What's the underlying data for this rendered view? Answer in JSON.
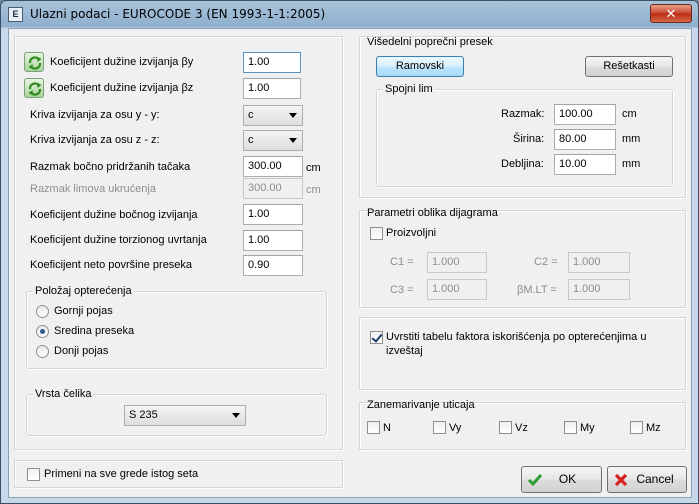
{
  "window": {
    "title": "Ulazni podaci - EUROCODE 3 (EN 1993-1-1:2005)",
    "close_label": "✕",
    "icon_label": "E"
  },
  "left": {
    "ky_label": "Koeficijent dužine izvijanja  βy",
    "ky_value": "1.00",
    "kz_label": "Koeficijent dužine izvijanja  βz",
    "kz_value": "1.00",
    "curve_y_label": "Kriva izvijanja za osu y - y:",
    "curve_y_value": "c",
    "curve_z_label": "Kriva izvijanja za osu z - z:",
    "curve_z_value": "c",
    "lateral_spacing_label": "Razmak bočno pridržanih tačaka",
    "lateral_spacing_value": "300.00",
    "lateral_spacing_unit": "cm",
    "stiffener_spacing_label": "Razmak limova ukrućenja",
    "stiffener_spacing_value": "300.00",
    "stiffener_spacing_unit": "cm",
    "lateral_buckling_label": "Koeficijent dužine bočnog izvijanja",
    "lateral_buckling_value": "1.00",
    "torsional_label": "Koeficijent dužine torzionog uvrtanja",
    "torsional_value": "1.00",
    "net_area_label": "Koeficijent neto površine preseka",
    "net_area_value": "0.90"
  },
  "load_position": {
    "legend": "Položaj opterećenja",
    "options": [
      "Gornji pojas",
      "Sredina preseka",
      "Donji pojas"
    ],
    "selected_index": 1
  },
  "steel": {
    "legend": "Vrsta čelika",
    "value": "S 235"
  },
  "apply_all": {
    "label": "Primeni na sve grede istog seta",
    "checked": false
  },
  "multi_section": {
    "legend": "Višedelni poprečni presek",
    "frame_button": "Ramovski",
    "lattice_button": "Rešetkasti",
    "plate": {
      "legend": "Spojni lim",
      "spacing_label": "Razmak:",
      "spacing_value": "100.00",
      "spacing_unit": "cm",
      "width_label": "Širina:",
      "width_value": "80.00",
      "width_unit": "mm",
      "thickness_label": "Debljina:",
      "thickness_value": "10.00",
      "thickness_unit": "mm"
    }
  },
  "diagram": {
    "legend": "Parametri oblika dijagrama",
    "custom_label": "Proizvoljni",
    "custom_checked": false,
    "c1_label": "C1 =",
    "c1_value": "1.000",
    "c2_label": "C2 =",
    "c2_value": "1.000",
    "c3_label": "C3 =",
    "c3_value": "1.000",
    "bmlt_label": "βM.LT =",
    "bmlt_value": "1.000"
  },
  "report": {
    "label_line1": "Uvrstiti tabelu faktora iskorišćenja po opterećenjima u",
    "label_line2": "izveštaj",
    "checked": true
  },
  "neglect": {
    "legend": "Zanemarivanje uticaja",
    "items": [
      "N",
      "Vy",
      "Vz",
      "My",
      "Mz"
    ]
  },
  "buttons": {
    "ok": "OK",
    "cancel": "Cancel"
  },
  "colors": {
    "ok_check": "#2e9e2e",
    "cancel_x": "#d42020",
    "refresh_green": "#3a9a2a"
  }
}
